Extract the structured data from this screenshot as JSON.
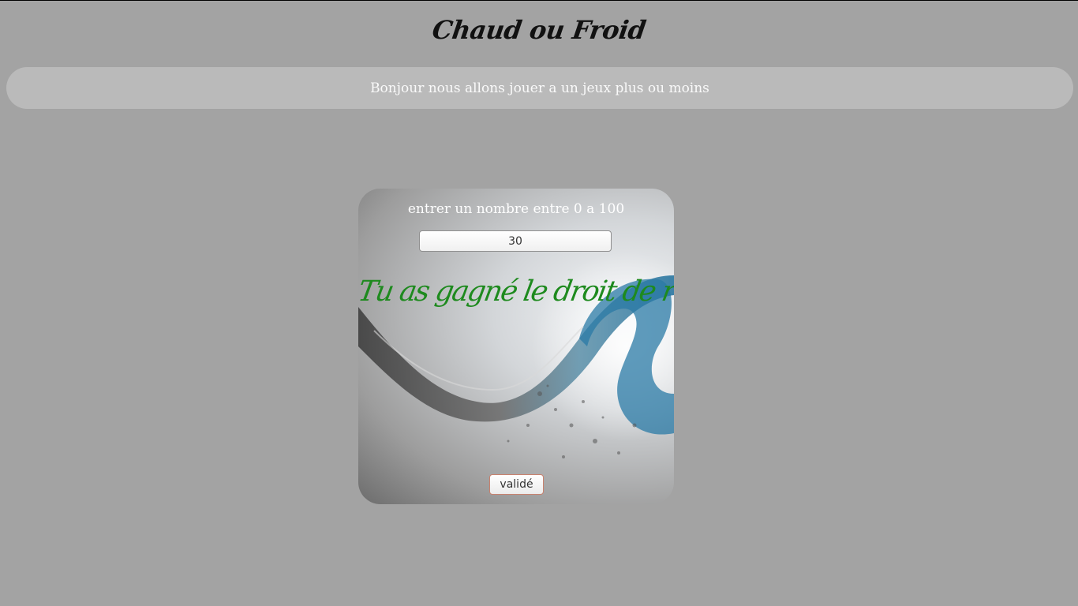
{
  "header": {
    "title": "Chaud ou Froid"
  },
  "banner": {
    "text": "Bonjour nous allons jouer a un jeux plus ou moins"
  },
  "game": {
    "prompt": "entrer un nombre entre 0 a 100",
    "input_value": "30",
    "result_message": "Tu as gagné le droit de rejouer !",
    "submit_label": "validé",
    "background_image": "water-splash-illustration",
    "result_color": "#1e8a1e"
  },
  "colors": {
    "page_background": "#a3a3a3",
    "banner_background": "#bababa"
  }
}
